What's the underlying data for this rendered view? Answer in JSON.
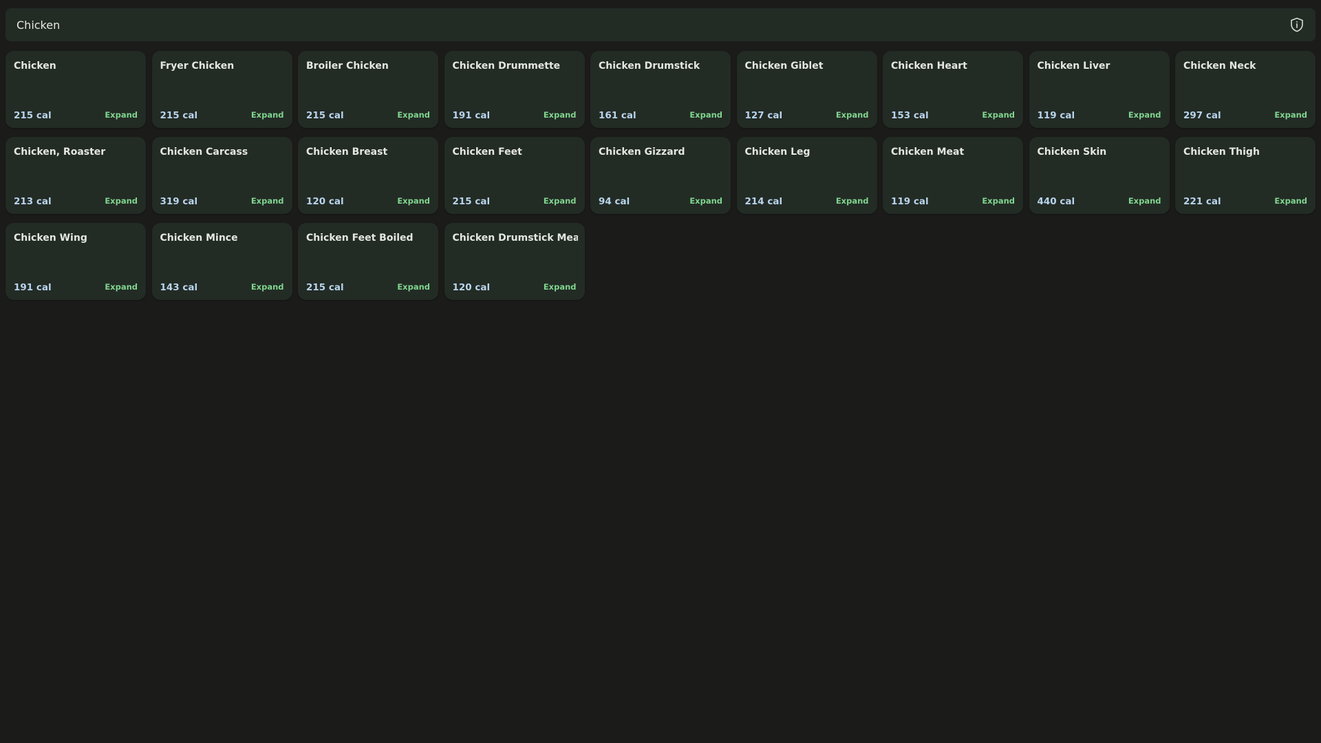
{
  "search": {
    "value": "Chicken",
    "info_icon": "shield-info-icon"
  },
  "expand_label": "Expand",
  "colors": {
    "background": "#1b1c1a",
    "card": "#232b25",
    "calories": "#b8d4ec",
    "expand": "#7fd58e"
  },
  "results": [
    {
      "name": "Chicken",
      "cal": "215 cal"
    },
    {
      "name": "Fryer Chicken",
      "cal": "215 cal"
    },
    {
      "name": "Broiler Chicken",
      "cal": "215 cal"
    },
    {
      "name": "Chicken Drummette",
      "cal": "191 cal"
    },
    {
      "name": "Chicken Drumstick",
      "cal": "161 cal"
    },
    {
      "name": "Chicken Giblet",
      "cal": "127 cal"
    },
    {
      "name": "Chicken Heart",
      "cal": "153 cal"
    },
    {
      "name": "Chicken Liver",
      "cal": "119 cal"
    },
    {
      "name": "Chicken Neck",
      "cal": "297 cal"
    },
    {
      "name": "Chicken, Roaster",
      "cal": "213 cal"
    },
    {
      "name": "Chicken Carcass",
      "cal": "319 cal"
    },
    {
      "name": "Chicken Breast",
      "cal": "120 cal"
    },
    {
      "name": "Chicken Feet",
      "cal": "215 cal"
    },
    {
      "name": "Chicken Gizzard",
      "cal": "94 cal"
    },
    {
      "name": "Chicken Leg",
      "cal": "214 cal"
    },
    {
      "name": "Chicken Meat",
      "cal": "119 cal"
    },
    {
      "name": "Chicken Skin",
      "cal": "440 cal"
    },
    {
      "name": "Chicken Thigh",
      "cal": "221 cal"
    },
    {
      "name": "Chicken Wing",
      "cal": "191 cal"
    },
    {
      "name": "Chicken Mince",
      "cal": "143 cal"
    },
    {
      "name": "Chicken Feet Boiled",
      "cal": "215 cal"
    },
    {
      "name": "Chicken Drumstick Meat",
      "cal": "120 cal"
    }
  ]
}
